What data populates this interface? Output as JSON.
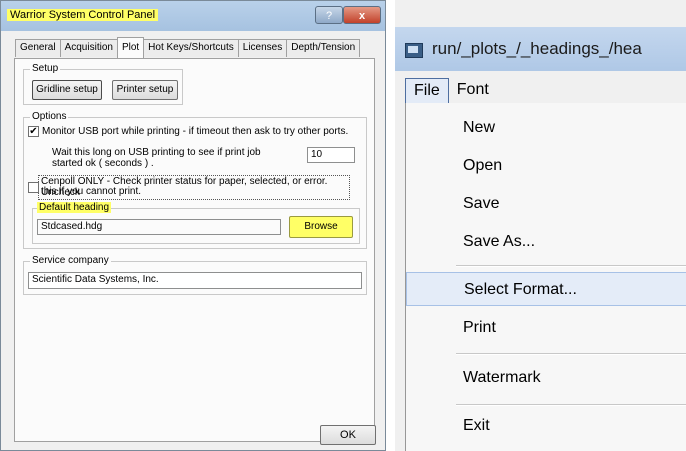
{
  "dialog": {
    "title": "Warrior System Control Panel",
    "help_label": "?",
    "close_label": "x",
    "tabs": [
      "General",
      "Acquisition",
      "Plot",
      "Hot Keys/Shortcuts",
      "Licenses",
      "Depth/Tension"
    ],
    "setup": {
      "label": "Setup",
      "gridline_button": "Gridline setup",
      "printer_button": "Printer setup"
    },
    "options": {
      "label": "Options",
      "monitor_usb_text": "Monitor USB port while printing - if timeout then ask  to try other ports.",
      "monitor_usb_checked": "✔",
      "wait_text_1": "Wait this long on USB printing to see if print job",
      "wait_text_2": "started ok ( seconds ) .",
      "wait_value": "10",
      "cenpoll_text_1": "Cenpoll ONLY - Check printer status for paper, selected, or error.  Uncheck",
      "cenpoll_text_2": "this if you cannot print.",
      "default_heading_label": "Default heading",
      "default_heading_value": "Stdcased.hdg",
      "browse_button": "Browse"
    },
    "service": {
      "label": "Service company",
      "value": "Scientific Data Systems, Inc."
    },
    "ok_button": "OK"
  },
  "menu_window": {
    "title": "run/_plots_/_headings_/hea",
    "menubar": [
      "File",
      "Font"
    ],
    "file_menu": [
      "New",
      "Open",
      "Save",
      "Save As...",
      "Select Format...",
      "Print",
      "Watermark",
      "Exit"
    ]
  },
  "colors": {
    "highlight_yellow": "#ffff66",
    "menu_highlight": "#e4ecf8",
    "titlebar_blue": "#b9d1ea"
  }
}
